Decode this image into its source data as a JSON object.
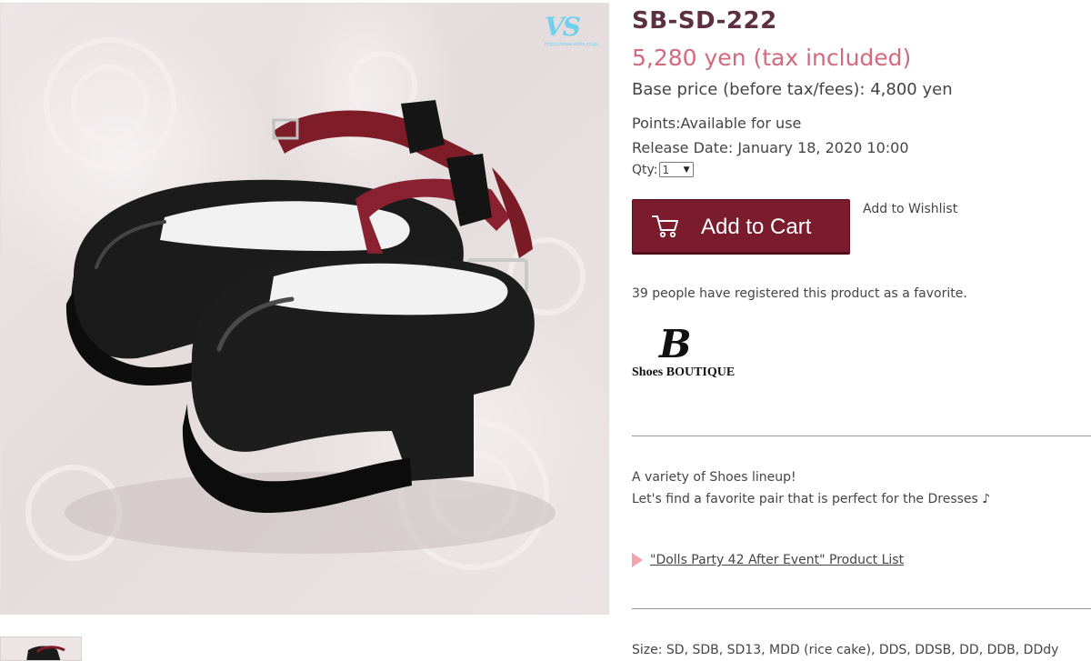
{
  "product": {
    "sku": "SB-SD-222",
    "price": "5,280 yen (tax included)",
    "base_price": "Base price (before tax/fees): 4,800 yen",
    "points": "Points:Available for use",
    "release_date": "Release Date: January 18, 2020 10:00",
    "qty_label": "Qty:",
    "qty_value": "1"
  },
  "actions": {
    "add_to_cart": "Add to Cart",
    "add_to_wishlist": "Add to Wishlist"
  },
  "favorites": {
    "text": "39 people have registered this product as a favorite."
  },
  "brand": {
    "logo_letter": "B",
    "logo_text": "Shoes BOUTIQUE",
    "watermark_glyph": "VS",
    "watermark_url": "https://www.volks.co.jp/"
  },
  "description": {
    "line1": "A variety of Shoes lineup!",
    "line2": "Let's find a favorite pair that is perfect for the Dresses ♪"
  },
  "related": {
    "link": "\"Dolls Party 42 After Event\" Product List"
  },
  "specs": {
    "size": "Size: SD, SDB, SD13, MDD (rice cake), DDS, DDSB, DD, DDB, DDdy"
  },
  "colors": {
    "accent": "#7a1c2e",
    "price": "#d06a7e",
    "title": "#5c3040",
    "bullet": "#f1a4b4",
    "watermark": "#6fd0ee"
  },
  "icons": {
    "cart": "shopping-cart-icon",
    "bullet": "triangle-right-icon"
  }
}
